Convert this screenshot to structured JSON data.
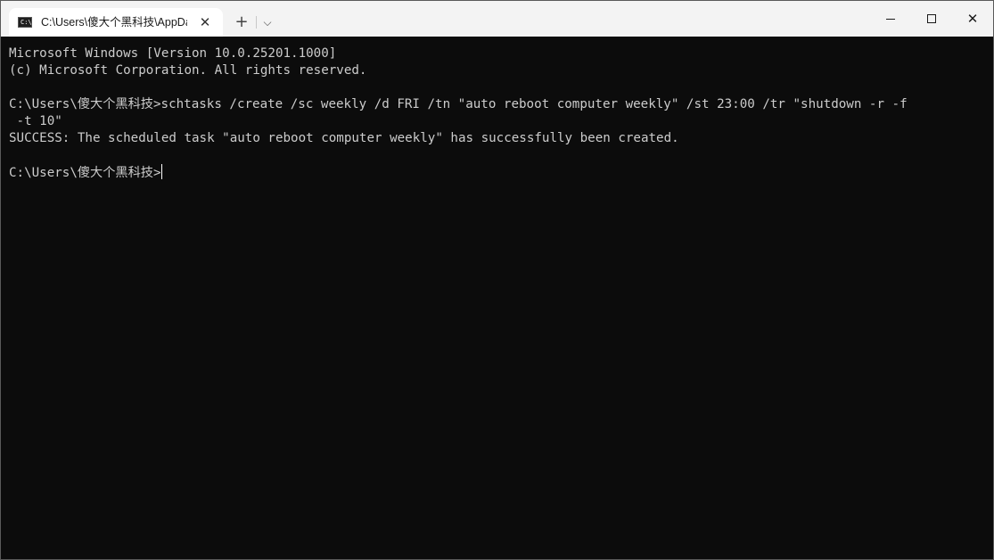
{
  "tab": {
    "icon": "command-prompt-icon",
    "icon_glyph": "C:\\",
    "title": "C:\\Users\\傻大个黑科技\\AppData",
    "close_glyph": "✕"
  },
  "titlebar": {
    "new_tab_glyph": "+",
    "dropdown_glyph": "⌵",
    "close_glyph": "✕"
  },
  "terminal": {
    "lines": [
      "Microsoft Windows [Version 10.0.25201.1000]",
      "(c) Microsoft Corporation. All rights reserved.",
      "",
      "C:\\Users\\傻大个黑科技>schtasks /create /sc weekly /d FRI /tn \"auto reboot computer weekly\" /st 23:00 /tr \"shutdown -r -f",
      " -t 10\"",
      "SUCCESS: The scheduled task \"auto reboot computer weekly\" has successfully been created.",
      "",
      "C:\\Users\\傻大个黑科技>"
    ]
  },
  "colors": {
    "terminal_bg": "#0c0c0c",
    "terminal_fg": "#cccccc",
    "titlebar_bg": "#f3f3f3",
    "active_tab_bg": "#ffffff"
  }
}
